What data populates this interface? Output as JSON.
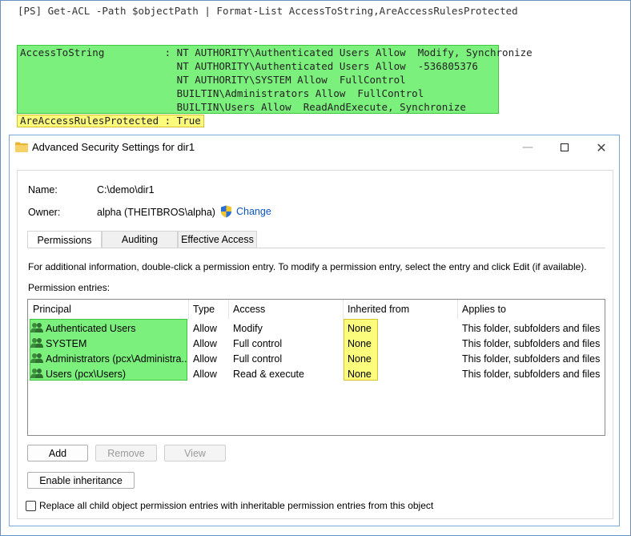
{
  "console": {
    "command_prompt": "[PS]",
    "command_cmdlet": "Get-ACL",
    "command_param": "-Path",
    "command_var": "$objectPath",
    "command_pipe": "|",
    "command_rest": "Format-List AccessToString,AreAccessRulesProtected",
    "acl_lines": [
      "AccessToString          : NT AUTHORITY\\Authenticated Users Allow  Modify, Synchronize",
      "                          NT AUTHORITY\\Authenticated Users Allow  -536805376",
      "                          NT AUTHORITY\\SYSTEM Allow  FullControl",
      "                          BUILTIN\\Administrators Allow  FullControl",
      "                          BUILTIN\\Users Allow  ReadAndExecute, Synchronize"
    ],
    "protected_line": "AreAccessRulesProtected : True",
    "colors": {
      "highlight_green": "#7cf07c",
      "highlight_yellow": "#fcfc7c"
    }
  },
  "dialog": {
    "title": "Advanced Security Settings for dir1",
    "icon": "folder-icon",
    "name_label": "Name:",
    "name_value": "C:\\demo\\dir1",
    "owner_label": "Owner:",
    "owner_value": "alpha (THEITBROS\\alpha)",
    "change_label": "Change",
    "change_icon": "uac-shield-icon",
    "tabs": [
      "Permissions",
      "Auditing",
      "Effective Access"
    ],
    "active_tab": "Permissions",
    "info_text": "For additional information, double-click a permission entry. To modify a permission entry, select the entry and click Edit (if available).",
    "entries_label": "Permission entries:",
    "columns": [
      "Principal",
      "Type",
      "Access",
      "Inherited from",
      "Applies to"
    ],
    "rows": [
      {
        "principal": "Authenticated Users",
        "type": "Allow",
        "access": "Modify",
        "inherited": "None",
        "applies": "This folder, subfolders and files"
      },
      {
        "principal": "SYSTEM",
        "type": "Allow",
        "access": "Full control",
        "inherited": "None",
        "applies": "This folder, subfolders and files"
      },
      {
        "principal": "Administrators (pcx\\Administra...",
        "type": "Allow",
        "access": "Full control",
        "inherited": "None",
        "applies": "This folder, subfolders and files"
      },
      {
        "principal": "Users (pcx\\Users)",
        "type": "Allow",
        "access": "Read & execute",
        "inherited": "None",
        "applies": "This folder, subfolders and files"
      }
    ],
    "buttons": {
      "add": "Add",
      "remove": "Remove",
      "view": "View",
      "enable_inheritance": "Enable inheritance"
    },
    "replace_checkbox_label": "Replace all child object permission entries with inheritable permission entries from this object",
    "replace_checked": false
  }
}
